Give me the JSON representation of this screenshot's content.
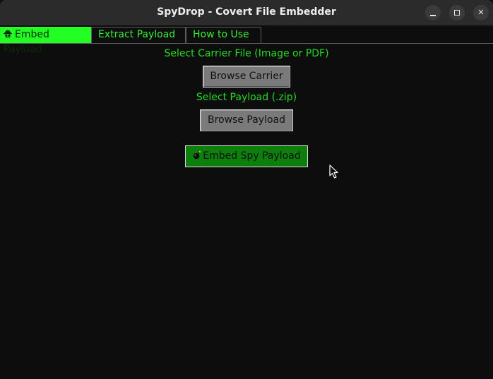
{
  "window": {
    "title": "SpyDrop - Covert File Embedder",
    "controls": [
      "minimize",
      "maximize",
      "close"
    ],
    "close_glyph": "✕"
  },
  "tabs": [
    {
      "label": "Embed Payload",
      "icon": "spy-icon",
      "active": true
    },
    {
      "label": "Extract Payload",
      "active": false
    },
    {
      "label": "How to Use",
      "active": false
    }
  ],
  "main": {
    "carrier_label": "Select Carrier File (Image or PDF)",
    "browse_carrier_label": "Browse Carrier",
    "payload_label": "Select Payload (.zip)",
    "browse_payload_label": "Browse Payload",
    "embed_label": "Embed Spy Payload",
    "embed_icon": "bomb-icon"
  },
  "colors": {
    "background": "#0d0d0d",
    "titlebar": "#2b2b2b",
    "accent_green": "#22ff22",
    "label_green": "#22dd22",
    "embed_button": "#0d7f0d",
    "button_gray": "#7a7a7a"
  }
}
